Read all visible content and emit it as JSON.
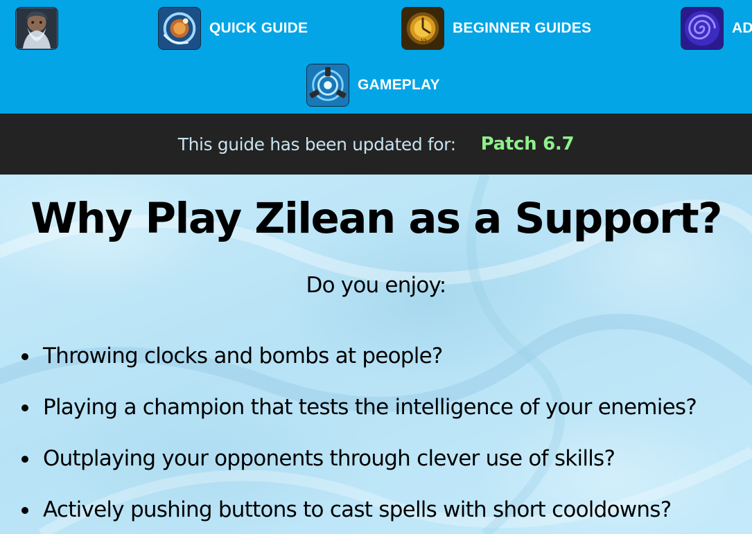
{
  "nav": {
    "background_color": "#03a5e6",
    "items": [
      {
        "label": "",
        "icon": "zilean-portrait-icon"
      },
      {
        "label": "QUICK GUIDE",
        "icon": "time-bomb-icon"
      },
      {
        "label": "BEGINNER GUIDES",
        "icon": "clock-icon"
      },
      {
        "label": "AD",
        "icon": "spiral-icon"
      },
      {
        "label": "GAMEPLAY",
        "icon": "rewind-icon"
      }
    ]
  },
  "patch_bar": {
    "text": "This guide has been updated for:",
    "version": "Patch 6.7",
    "version_color": "#8ff08a"
  },
  "main": {
    "title": "Why Play Zilean as a Support?",
    "subtitle": "Do you enjoy:",
    "bullets": [
      "Throwing clocks and bombs at people?",
      "Playing a champion that tests the intelligence of your enemies?",
      "Outplaying your opponents through clever use of skills?",
      "Actively pushing buttons to cast spells with short cooldowns?"
    ]
  }
}
